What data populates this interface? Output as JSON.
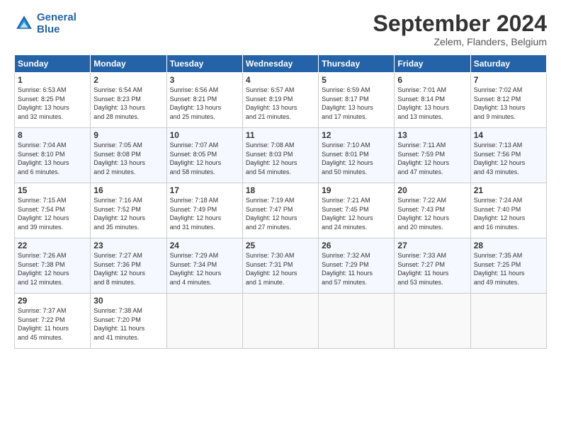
{
  "header": {
    "logo_line1": "General",
    "logo_line2": "Blue",
    "month_title": "September 2024",
    "location": "Zelem, Flanders, Belgium"
  },
  "weekdays": [
    "Sunday",
    "Monday",
    "Tuesday",
    "Wednesday",
    "Thursday",
    "Friday",
    "Saturday"
  ],
  "weeks": [
    [
      {
        "day": "1",
        "info": "Sunrise: 6:53 AM\nSunset: 8:25 PM\nDaylight: 13 hours\nand 32 minutes."
      },
      {
        "day": "2",
        "info": "Sunrise: 6:54 AM\nSunset: 8:23 PM\nDaylight: 13 hours\nand 28 minutes."
      },
      {
        "day": "3",
        "info": "Sunrise: 6:56 AM\nSunset: 8:21 PM\nDaylight: 13 hours\nand 25 minutes."
      },
      {
        "day": "4",
        "info": "Sunrise: 6:57 AM\nSunset: 8:19 PM\nDaylight: 13 hours\nand 21 minutes."
      },
      {
        "day": "5",
        "info": "Sunrise: 6:59 AM\nSunset: 8:17 PM\nDaylight: 13 hours\nand 17 minutes."
      },
      {
        "day": "6",
        "info": "Sunrise: 7:01 AM\nSunset: 8:14 PM\nDaylight: 13 hours\nand 13 minutes."
      },
      {
        "day": "7",
        "info": "Sunrise: 7:02 AM\nSunset: 8:12 PM\nDaylight: 13 hours\nand 9 minutes."
      }
    ],
    [
      {
        "day": "8",
        "info": "Sunrise: 7:04 AM\nSunset: 8:10 PM\nDaylight: 13 hours\nand 6 minutes."
      },
      {
        "day": "9",
        "info": "Sunrise: 7:05 AM\nSunset: 8:08 PM\nDaylight: 13 hours\nand 2 minutes."
      },
      {
        "day": "10",
        "info": "Sunrise: 7:07 AM\nSunset: 8:05 PM\nDaylight: 12 hours\nand 58 minutes."
      },
      {
        "day": "11",
        "info": "Sunrise: 7:08 AM\nSunset: 8:03 PM\nDaylight: 12 hours\nand 54 minutes."
      },
      {
        "day": "12",
        "info": "Sunrise: 7:10 AM\nSunset: 8:01 PM\nDaylight: 12 hours\nand 50 minutes."
      },
      {
        "day": "13",
        "info": "Sunrise: 7:11 AM\nSunset: 7:59 PM\nDaylight: 12 hours\nand 47 minutes."
      },
      {
        "day": "14",
        "info": "Sunrise: 7:13 AM\nSunset: 7:56 PM\nDaylight: 12 hours\nand 43 minutes."
      }
    ],
    [
      {
        "day": "15",
        "info": "Sunrise: 7:15 AM\nSunset: 7:54 PM\nDaylight: 12 hours\nand 39 minutes."
      },
      {
        "day": "16",
        "info": "Sunrise: 7:16 AM\nSunset: 7:52 PM\nDaylight: 12 hours\nand 35 minutes."
      },
      {
        "day": "17",
        "info": "Sunrise: 7:18 AM\nSunset: 7:49 PM\nDaylight: 12 hours\nand 31 minutes."
      },
      {
        "day": "18",
        "info": "Sunrise: 7:19 AM\nSunset: 7:47 PM\nDaylight: 12 hours\nand 27 minutes."
      },
      {
        "day": "19",
        "info": "Sunrise: 7:21 AM\nSunset: 7:45 PM\nDaylight: 12 hours\nand 24 minutes."
      },
      {
        "day": "20",
        "info": "Sunrise: 7:22 AM\nSunset: 7:43 PM\nDaylight: 12 hours\nand 20 minutes."
      },
      {
        "day": "21",
        "info": "Sunrise: 7:24 AM\nSunset: 7:40 PM\nDaylight: 12 hours\nand 16 minutes."
      }
    ],
    [
      {
        "day": "22",
        "info": "Sunrise: 7:26 AM\nSunset: 7:38 PM\nDaylight: 12 hours\nand 12 minutes."
      },
      {
        "day": "23",
        "info": "Sunrise: 7:27 AM\nSunset: 7:36 PM\nDaylight: 12 hours\nand 8 minutes."
      },
      {
        "day": "24",
        "info": "Sunrise: 7:29 AM\nSunset: 7:34 PM\nDaylight: 12 hours\nand 4 minutes."
      },
      {
        "day": "25",
        "info": "Sunrise: 7:30 AM\nSunset: 7:31 PM\nDaylight: 12 hours\nand 1 minute."
      },
      {
        "day": "26",
        "info": "Sunrise: 7:32 AM\nSunset: 7:29 PM\nDaylight: 11 hours\nand 57 minutes."
      },
      {
        "day": "27",
        "info": "Sunrise: 7:33 AM\nSunset: 7:27 PM\nDaylight: 11 hours\nand 53 minutes."
      },
      {
        "day": "28",
        "info": "Sunrise: 7:35 AM\nSunset: 7:25 PM\nDaylight: 11 hours\nand 49 minutes."
      }
    ],
    [
      {
        "day": "29",
        "info": "Sunrise: 7:37 AM\nSunset: 7:22 PM\nDaylight: 11 hours\nand 45 minutes."
      },
      {
        "day": "30",
        "info": "Sunrise: 7:38 AM\nSunset: 7:20 PM\nDaylight: 11 hours\nand 41 minutes."
      },
      null,
      null,
      null,
      null,
      null
    ]
  ]
}
